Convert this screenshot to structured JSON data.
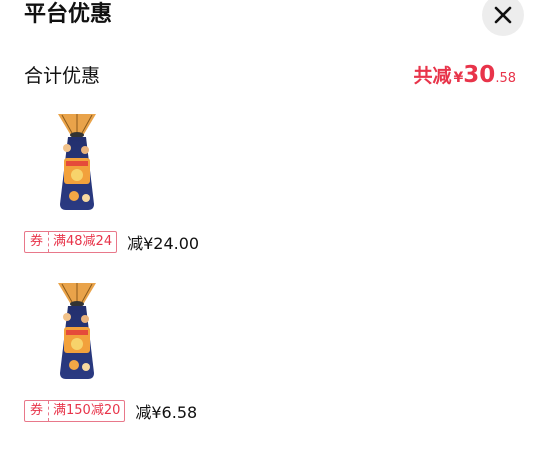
{
  "title": "平台优惠",
  "summary": {
    "label": "合计优惠",
    "prefix": "共减",
    "currency": "¥",
    "amount_int": "30",
    "amount_dec": ".58"
  },
  "items": [
    {
      "coupon_type": "券",
      "coupon_condition": "满48减24",
      "discount": "减¥24.00"
    },
    {
      "coupon_type": "券",
      "coupon_condition": "满150减20",
      "discount": "减¥6.58"
    }
  ],
  "colors": {
    "accent": "#e8344a",
    "close_bg": "#ededed"
  },
  "icons": {
    "close": "close-icon",
    "product": "product-thumbnail"
  }
}
